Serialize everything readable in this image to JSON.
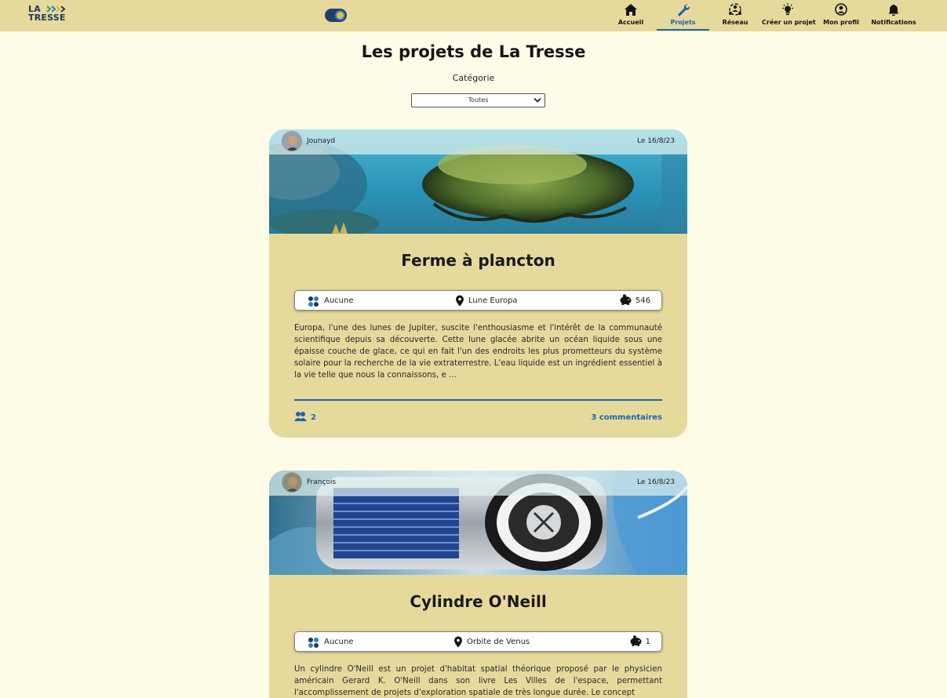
{
  "header": {
    "logo_line1": "LA",
    "logo_line2": "TRESSE",
    "nav": [
      {
        "label": "Accueil",
        "icon": "home-icon",
        "active": false
      },
      {
        "label": "Projets",
        "icon": "wrench-icon",
        "active": true
      },
      {
        "label": "Réseau",
        "icon": "network-icon",
        "active": false
      },
      {
        "label": "Créer un projet",
        "icon": "lightbulb-icon",
        "active": false
      },
      {
        "label": "Mon profil",
        "icon": "profile-icon",
        "active": false
      },
      {
        "label": "Notifications",
        "icon": "bell-icon",
        "active": false
      }
    ]
  },
  "page": {
    "title": "Les projets de La Tresse",
    "category_label": "Catégorie",
    "category_selected": "Toutes"
  },
  "projects": [
    {
      "author": "Jounayd",
      "date": "Le 16/8/23",
      "title": "Ferme à plancton",
      "category": "Aucune",
      "location": "Lune Europa",
      "funding": "546",
      "description": "Europa, l'une des lunes de Jupiter, suscite l'enthousiasme et l'intérêt de la communauté scientifique depuis sa découverte. Cette lune glacée abrite un océan liquide sous une épaisse couche de glace, ce qui en fait l'un des endroits les plus prometteurs du système solaire pour la recherche de la vie extraterrestre. L'eau liquide est un ingrédient essentiel à la vie telle que nous la connaissons, e ...",
      "members": "2",
      "comments": "3 commentaires"
    },
    {
      "author": "François",
      "date": "Le 16/8/23",
      "title": "Cylindre O'Neill",
      "category": "Aucune",
      "location": "Orbite de Venus",
      "funding": "1",
      "description": "Un cylindre O'Neill est un projet d'habitat spatial théorique proposé par le physicien américain Gerard K. O'Neill dans son livre Les Villes de l'espace, permettant l'accomplissement de projets d'exploration spatiale de très longue durée. Le concept"
    }
  ],
  "colors": {
    "header_bg": "#e6d99c",
    "page_bg": "#fefbe9",
    "card_bg": "#e6d99c",
    "accent_blue": "#2164ad"
  }
}
